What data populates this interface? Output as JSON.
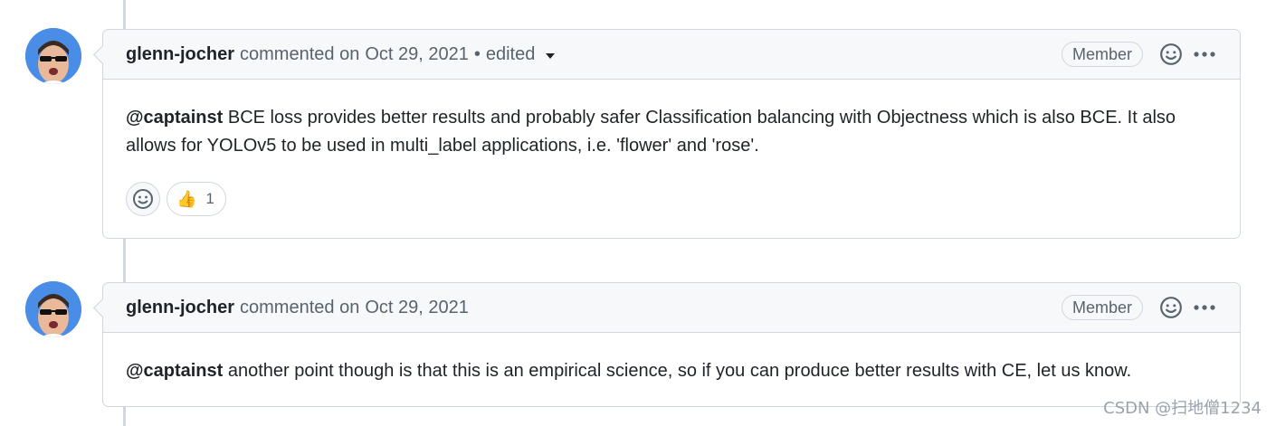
{
  "comments": [
    {
      "author": "glenn-jocher",
      "action": "commented on",
      "date": "Oct 29, 2021",
      "separator": "•",
      "edited": "edited",
      "badge": "Member",
      "mention": "@captainst",
      "text_line1": " BCE loss provides better results and probably safer Classification balancing with Objectness which is also BCE. It also",
      "text_line2": "allows for YOLOv5 to be used in multi_label applications, i.e. 'flower' and 'rose'.",
      "reactions": [
        {
          "emoji": "👍",
          "count": "1"
        }
      ]
    },
    {
      "author": "glenn-jocher",
      "action": "commented on",
      "date": "Oct 29, 2021",
      "badge": "Member",
      "mention": "@captainst",
      "text_line1": " another point though is that this is an empirical science, so if you can produce better results with CE, let us know."
    }
  ],
  "icons": {
    "reaction": "smiley-icon",
    "more": "kebab-horizontal-icon",
    "dropdown": "triangle-down-icon",
    "add_reaction": "smiley-icon"
  },
  "watermark": "CSDN @扫地僧1234",
  "colors": {
    "border": "#d0d7de",
    "header_bg": "#f6f8fa",
    "text": "#1f2328",
    "muted": "#59636e"
  }
}
